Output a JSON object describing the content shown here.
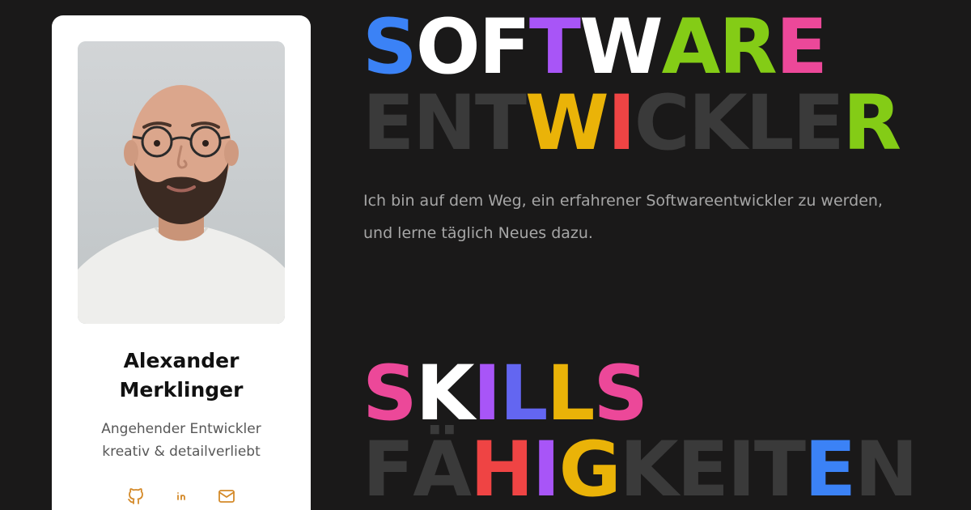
{
  "profile": {
    "name_line1": "Alexander",
    "name_line2": "Merklinger",
    "tagline_line1": "Angehender Entwickler",
    "tagline_line2": "kreativ & detailverliebt",
    "socials": [
      {
        "icon": "github-icon",
        "color": "#d48a2a"
      },
      {
        "icon": "linkedin-icon",
        "color": "#d48a2a"
      },
      {
        "icon": "mail-icon",
        "color": "#d48a2a"
      }
    ]
  },
  "hero": {
    "line1": [
      {
        "char": "S",
        "color": "#3b82f6"
      },
      {
        "char": "O",
        "color": "#ffffff"
      },
      {
        "char": "F",
        "color": "#ffffff"
      },
      {
        "char": "T",
        "color": "#a855f7"
      },
      {
        "char": "W",
        "color": "#ffffff"
      },
      {
        "char": "A",
        "color": "#84cc16"
      },
      {
        "char": "R",
        "color": "#84cc16"
      },
      {
        "char": "E",
        "color": "#ec4899"
      }
    ],
    "line2": [
      {
        "char": "E",
        "color": "#3a3a3a"
      },
      {
        "char": "N",
        "color": "#3a3a3a"
      },
      {
        "char": "T",
        "color": "#3a3a3a"
      },
      {
        "char": "W",
        "color": "#eab308"
      },
      {
        "char": "I",
        "color": "#ef4444"
      },
      {
        "char": "C",
        "color": "#3a3a3a"
      },
      {
        "char": "K",
        "color": "#3a3a3a"
      },
      {
        "char": "L",
        "color": "#3a3a3a"
      },
      {
        "char": "E",
        "color": "#3a3a3a"
      },
      {
        "char": "R",
        "color": "#84cc16"
      }
    ],
    "intro": "Ich bin auf dem Weg, ein erfahrener Softwareentwickler zu werden, und lerne täglich Neues dazu."
  },
  "skills": {
    "line1": [
      {
        "char": "S",
        "color": "#ec4899"
      },
      {
        "char": "K",
        "color": "#ffffff"
      },
      {
        "char": "I",
        "color": "#a855f7"
      },
      {
        "char": "L",
        "color": "#6366f1"
      },
      {
        "char": "L",
        "color": "#eab308"
      },
      {
        "char": "S",
        "color": "#ec4899"
      }
    ],
    "line2": [
      {
        "char": "F",
        "color": "#3a3a3a"
      },
      {
        "char": "Ä",
        "color": "#3a3a3a"
      },
      {
        "char": "H",
        "color": "#ef4444"
      },
      {
        "char": "I",
        "color": "#a855f7"
      },
      {
        "char": "G",
        "color": "#eab308"
      },
      {
        "char": "K",
        "color": "#3a3a3a"
      },
      {
        "char": "E",
        "color": "#3a3a3a"
      },
      {
        "char": "I",
        "color": "#3a3a3a"
      },
      {
        "char": "T",
        "color": "#3a3a3a"
      },
      {
        "char": "E",
        "color": "#3b82f6"
      },
      {
        "char": "N",
        "color": "#3a3a3a"
      }
    ]
  }
}
